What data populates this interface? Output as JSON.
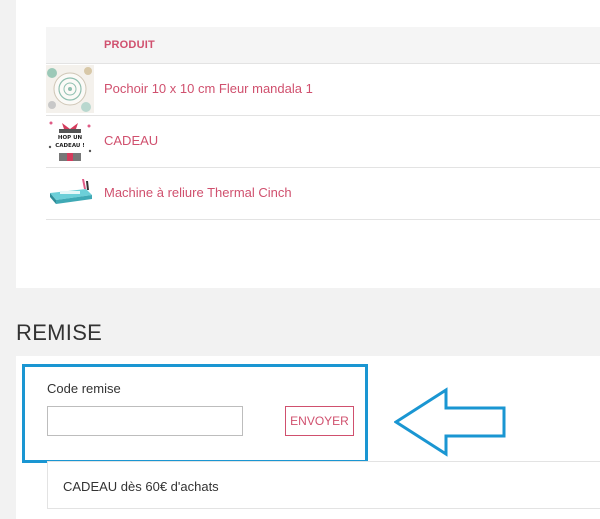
{
  "products_table": {
    "header": "PRODUIT",
    "rows": [
      {
        "label": "Pochoir 10 x 10 cm Fleur mandala 1",
        "thumbnail": "mandala-stencil-thumbnail"
      },
      {
        "label": "CADEAU",
        "thumbnail": "gift-thumbnail",
        "thumbnail_text": "HOP UN CADEAU !"
      },
      {
        "label": "Machine à reliure Thermal Cinch",
        "thumbnail": "binding-machine-thumbnail"
      }
    ]
  },
  "remise": {
    "title": "REMISE",
    "code_label": "Code remise",
    "code_value": "",
    "code_placeholder": "",
    "submit_label": "ENVOYER",
    "offer_text": "CADEAU dès 60€ d'achats"
  },
  "annotation": {
    "highlight_color": "#1a96d2",
    "arrow_icon": "left-arrow-icon"
  },
  "colors": {
    "accent": "#d0506e",
    "page_background": "#f2f2f2"
  }
}
